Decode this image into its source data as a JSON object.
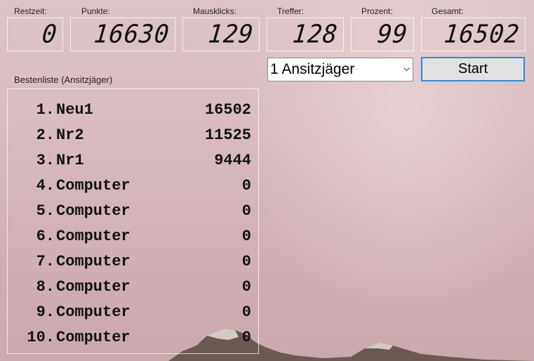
{
  "counters": {
    "restzeit": {
      "label": "Restzeit:",
      "value": "0"
    },
    "punkte": {
      "label": "Punkte:",
      "value": "16630"
    },
    "mausklicks": {
      "label": "Mausklicks:",
      "value": "129"
    },
    "treffer": {
      "label": "Treffer:",
      "value": "128"
    },
    "prozent": {
      "label": "Prozent:",
      "value": "99"
    },
    "gesamt": {
      "label": "Gesamt:",
      "value": "16502"
    }
  },
  "mode_select": {
    "selected": "1 Ansitzjäger"
  },
  "start_button": {
    "label": "Start"
  },
  "leaderboard": {
    "title": "Bestenliste (Ansitzjäger)",
    "rows": [
      {
        "rank": "1.",
        "name": "Neu1",
        "points": "16502"
      },
      {
        "rank": "2.",
        "name": "Nr2",
        "points": "11525"
      },
      {
        "rank": "3.",
        "name": "Nr1",
        "points": "9444"
      },
      {
        "rank": "4.",
        "name": "Computer",
        "points": "0"
      },
      {
        "rank": "5.",
        "name": "Computer",
        "points": "0"
      },
      {
        "rank": "6.",
        "name": "Computer",
        "points": "0"
      },
      {
        "rank": "7.",
        "name": "Computer",
        "points": "0"
      },
      {
        "rank": "8.",
        "name": "Computer",
        "points": "0"
      },
      {
        "rank": "9.",
        "name": "Computer",
        "points": "0"
      },
      {
        "rank": "10.",
        "name": "Computer",
        "points": "0"
      }
    ]
  },
  "icons": {
    "dropdown": "chevron-down-icon"
  }
}
